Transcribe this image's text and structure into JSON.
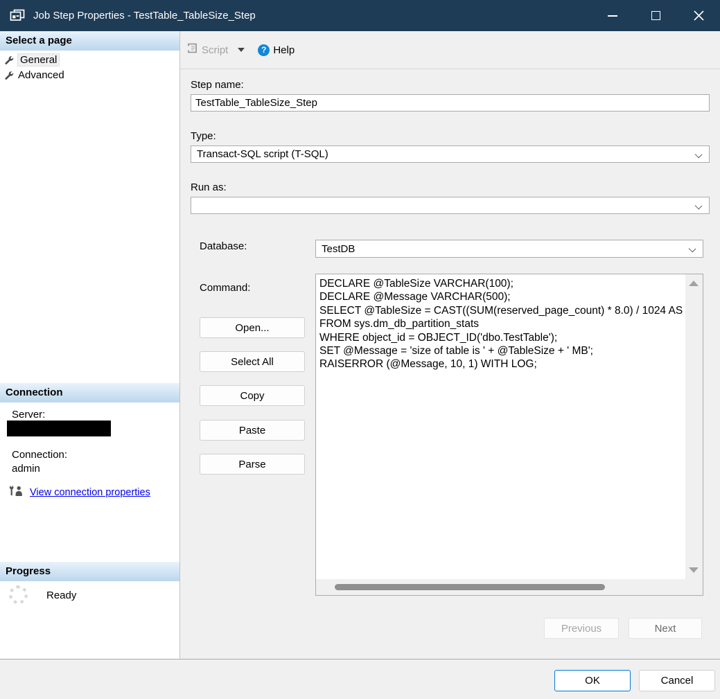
{
  "window": {
    "title": "Job Step Properties - TestTable_TableSize_Step"
  },
  "toolbar": {
    "script_label": "Script",
    "help_label": "Help"
  },
  "sidebar": {
    "select_page": {
      "header": "Select a page",
      "items": [
        {
          "label": "General",
          "selected": true
        },
        {
          "label": "Advanced",
          "selected": false
        }
      ]
    },
    "connection": {
      "header": "Connection",
      "server_label": "Server:",
      "connection_label": "Connection:",
      "connection_value": "admin",
      "link_label": "View connection properties"
    },
    "progress": {
      "header": "Progress",
      "status": "Ready"
    }
  },
  "form": {
    "step_name": {
      "label": "Step name:",
      "value": "TestTable_TableSize_Step"
    },
    "type": {
      "label": "Type:",
      "value": "Transact-SQL script (T-SQL)"
    },
    "run_as": {
      "label": "Run as:",
      "value": ""
    },
    "database": {
      "label": "Database:",
      "value": "TestDB"
    },
    "command": {
      "label": "Command:",
      "lines": [
        "DECLARE @TableSize VARCHAR(100);",
        "DECLARE @Message VARCHAR(500);",
        "SELECT @TableSize = CAST((SUM(reserved_page_count) * 8.0) / 1024 AS",
        "FROM sys.dm_db_partition_stats",
        "WHERE object_id = OBJECT_ID('dbo.TestTable');",
        "SET @Message = 'size of table is ' + @TableSize + ' MB';",
        "RAISERROR (@Message, 10, 1) WITH LOG;"
      ]
    },
    "buttons": [
      "Open...",
      "Select All",
      "Copy",
      "Paste",
      "Parse"
    ]
  },
  "nav": {
    "previous": "Previous",
    "next": "Next"
  },
  "footer": {
    "ok": "OK",
    "cancel": "Cancel"
  },
  "icons": {
    "app": "layered-windows",
    "script": "script-page",
    "script_dropdown": "chevron-down",
    "help": "question-circle",
    "page_item": "wrench",
    "connection_link": "user-wrench",
    "progress": "spinner-ring",
    "minimize": "minimize",
    "maximize": "maximize",
    "close": "close"
  },
  "colors": {
    "titlebar": "#1e3c55",
    "main_background": "#f0f0f0",
    "header_gradient_top": "#e9f3fb",
    "header_gradient_bottom": "#bdd7ec",
    "ok_border": "#0078d7",
    "link": "#0000ee",
    "help_badge": "#1286d8"
  }
}
